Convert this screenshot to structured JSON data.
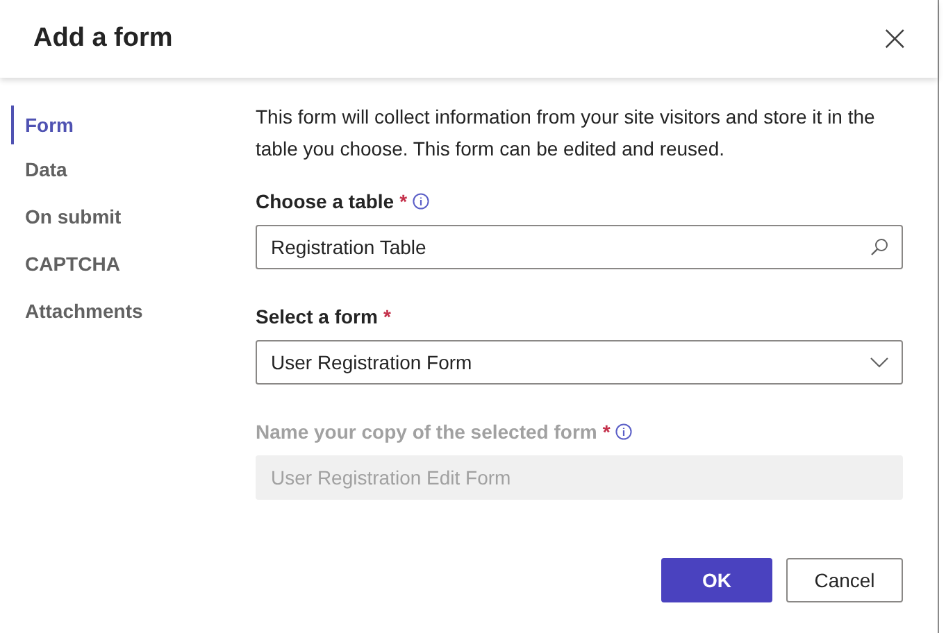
{
  "dialog": {
    "title": "Add a form",
    "close_glyph": "×"
  },
  "nav": [
    {
      "label": "Form",
      "selected": true
    },
    {
      "label": "Data",
      "selected": false
    },
    {
      "label": "On submit",
      "selected": false
    },
    {
      "label": "CAPTCHA",
      "selected": false
    },
    {
      "label": "Attachments",
      "selected": false
    }
  ],
  "description": "This form will collect information from your site visitors and store it in the table you choose. This form can be edited and reused.",
  "fields": [
    {
      "kind": "search",
      "label": "Choose a table",
      "required_mark": "*",
      "info": true,
      "value": "Registration Table",
      "disabled": false
    },
    {
      "kind": "dropdown",
      "label": "Select a form",
      "required_mark": "*",
      "info": false,
      "value": "User Registration Form",
      "disabled": false
    },
    {
      "kind": "text",
      "label": "Name your copy of the selected form",
      "required_mark": "*",
      "info": true,
      "value": "User Registration Edit Form",
      "disabled": true
    }
  ],
  "buttons": [
    {
      "label": "OK",
      "kind": "primary"
    },
    {
      "label": "Cancel",
      "kind": "secondary"
    }
  ]
}
